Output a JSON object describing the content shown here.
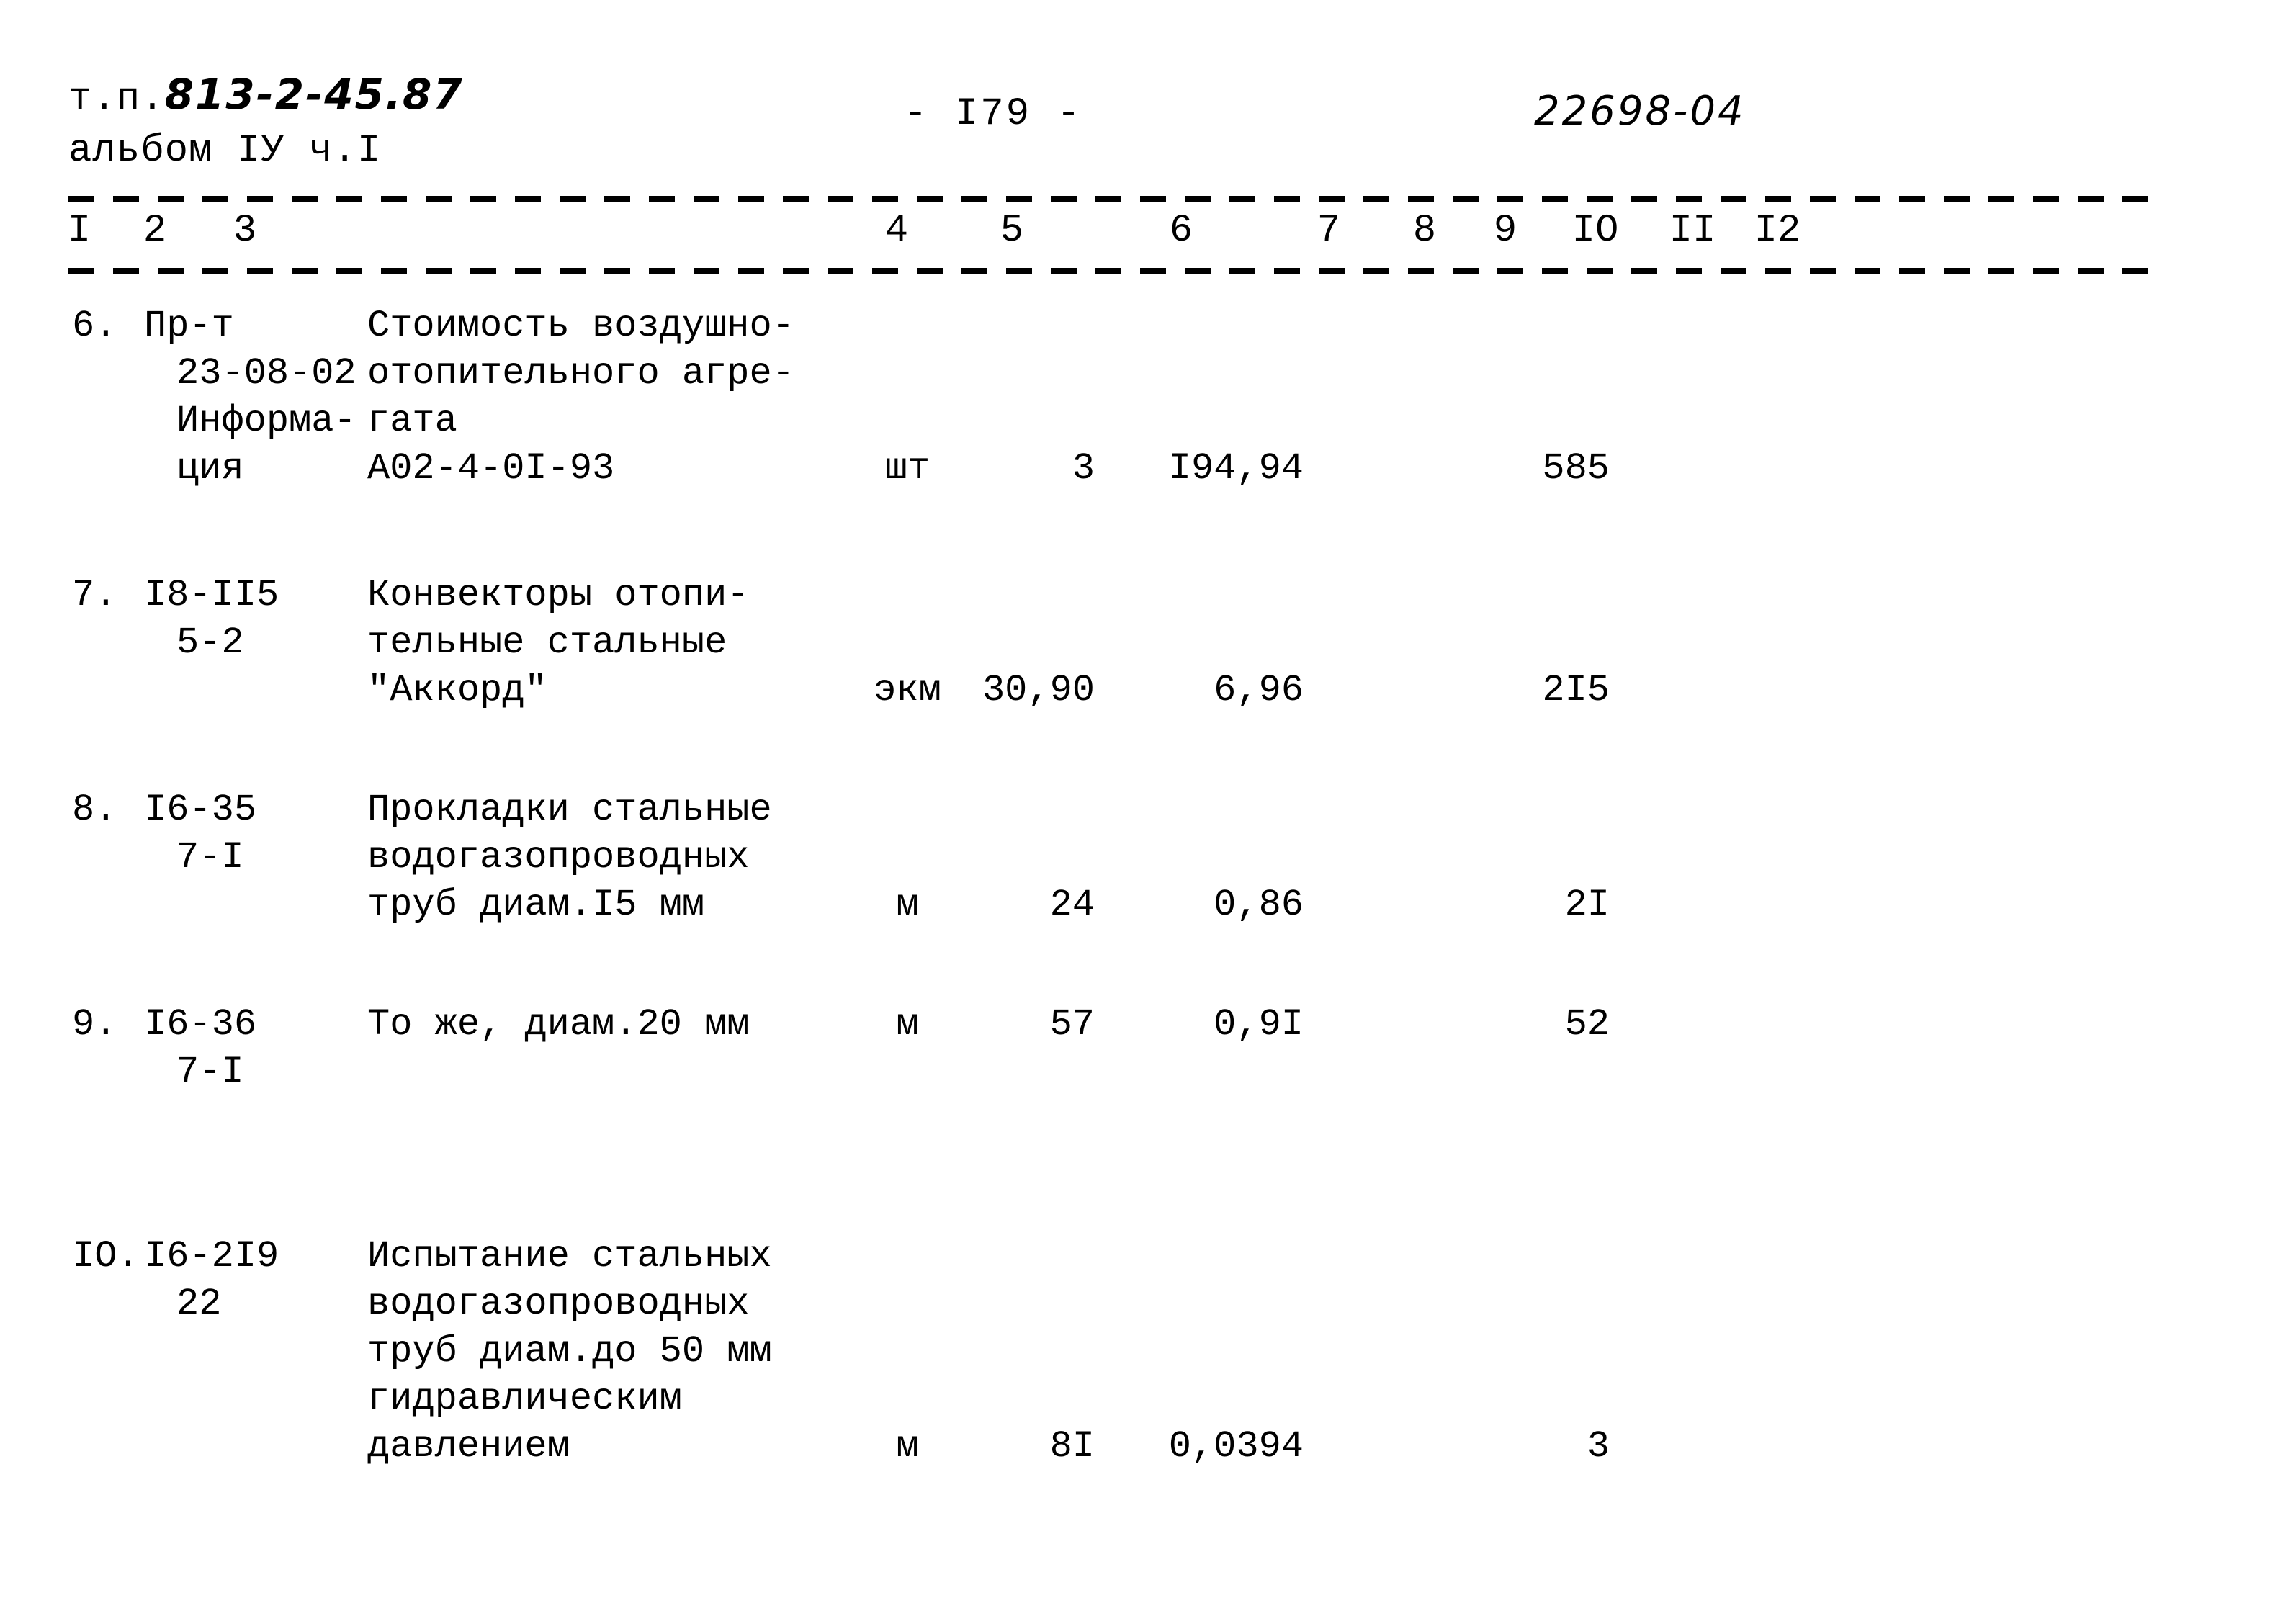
{
  "header": {
    "doc_prefix": "т.п.",
    "doc_number": "813-2-45.87",
    "album_line": "альбом IУ ч.I",
    "page_label": "- I79 -",
    "archive_code": "22698-04"
  },
  "table": {
    "column_numbers": [
      "I",
      "2",
      "3",
      "4",
      "5",
      "6",
      "7",
      "8",
      "9",
      "IO",
      "II",
      "I2"
    ],
    "rows": [
      {
        "no": "6.",
        "code_lines": [
          "Пр-т",
          "23-08-02",
          "Информа-",
          "ция"
        ],
        "name_lines": [
          "Стоимость воздушно-",
          "отопительного агре-",
          "гата",
          "А02-4-0I-93"
        ],
        "unit": "шт",
        "quantity": "3",
        "price": "I94,94",
        "col7": "",
        "col8": "",
        "total": "585",
        "col10": "",
        "col11": "",
        "col12": "",
        "value_line_index": 3
      },
      {
        "no": "7.",
        "code_lines": [
          "I8-II5",
          "5-2"
        ],
        "name_lines": [
          "Конвекторы отопи-",
          "тельные стальные",
          "\"Аккорд\""
        ],
        "unit": "экм",
        "quantity": "30,90",
        "price": "6,96",
        "col7": "",
        "col8": "",
        "total": "2I5",
        "col10": "",
        "col11": "",
        "col12": "",
        "value_line_index": 2
      },
      {
        "no": "8.",
        "code_lines": [
          "I6-35",
          "7-I"
        ],
        "name_lines": [
          "Прокладки стальные",
          "водогазопроводных",
          "труб диам.I5 мм"
        ],
        "unit": "м",
        "quantity": "24",
        "price": "0,86",
        "col7": "",
        "col8": "",
        "total": "2I",
        "col10": "",
        "col11": "",
        "col12": "",
        "value_line_index": 2
      },
      {
        "no": "9.",
        "code_lines": [
          "I6-36",
          "7-I"
        ],
        "name_lines": [
          "То же, диам.20 мм"
        ],
        "unit": "м",
        "quantity": "57",
        "price": "0,9I",
        "col7": "",
        "col8": "",
        "total": "52",
        "col10": "",
        "col11": "",
        "col12": "",
        "value_line_index": 0
      },
      {
        "no": "IO.",
        "code_lines": [
          "I6-2I9",
          "22"
        ],
        "name_lines": [
          "Испытание стальных",
          "водогазопроводных",
          "труб диам.до 50 мм",
          "гидравлическим",
          "давлением"
        ],
        "unit": "м",
        "quantity": "8I",
        "price": "0,0394",
        "col7": "",
        "col8": "",
        "total": "3",
        "col10": "",
        "col11": "",
        "col12": "",
        "value_line_index": 4
      }
    ]
  }
}
